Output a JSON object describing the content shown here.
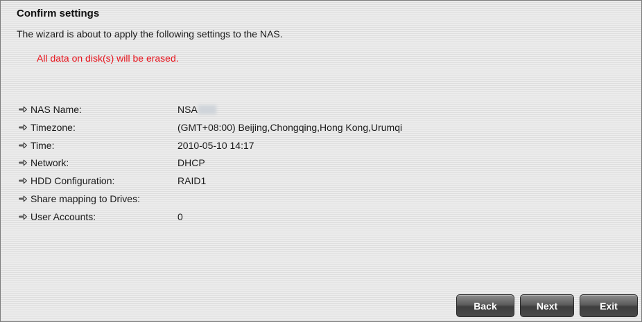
{
  "page": {
    "title": "Confirm settings",
    "intro": "The wizard is about to apply the following settings to the NAS.",
    "warning": "All data on disk(s) will be erased."
  },
  "colors": {
    "warning": "#e8141d",
    "button_bg": "#4a4a4a"
  },
  "settings": [
    {
      "label": "NAS Name:",
      "value": "NSA",
      "redacted": true
    },
    {
      "label": "Timezone:",
      "value": "(GMT+08:00) Beijing,Chongqing,Hong Kong,Urumqi"
    },
    {
      "label": "Time:",
      "value": "2010-05-10 14:17"
    },
    {
      "label": "Network:",
      "value": "DHCP"
    },
    {
      "label": "HDD Configuration:",
      "value": "RAID1"
    },
    {
      "label": "Share mapping to Drives:",
      "value": ""
    },
    {
      "label": "User Accounts:",
      "value": "0"
    }
  ],
  "row_icon": "arrow-right-icon",
  "buttons": {
    "back": "Back",
    "next": "Next",
    "exit": "Exit"
  }
}
